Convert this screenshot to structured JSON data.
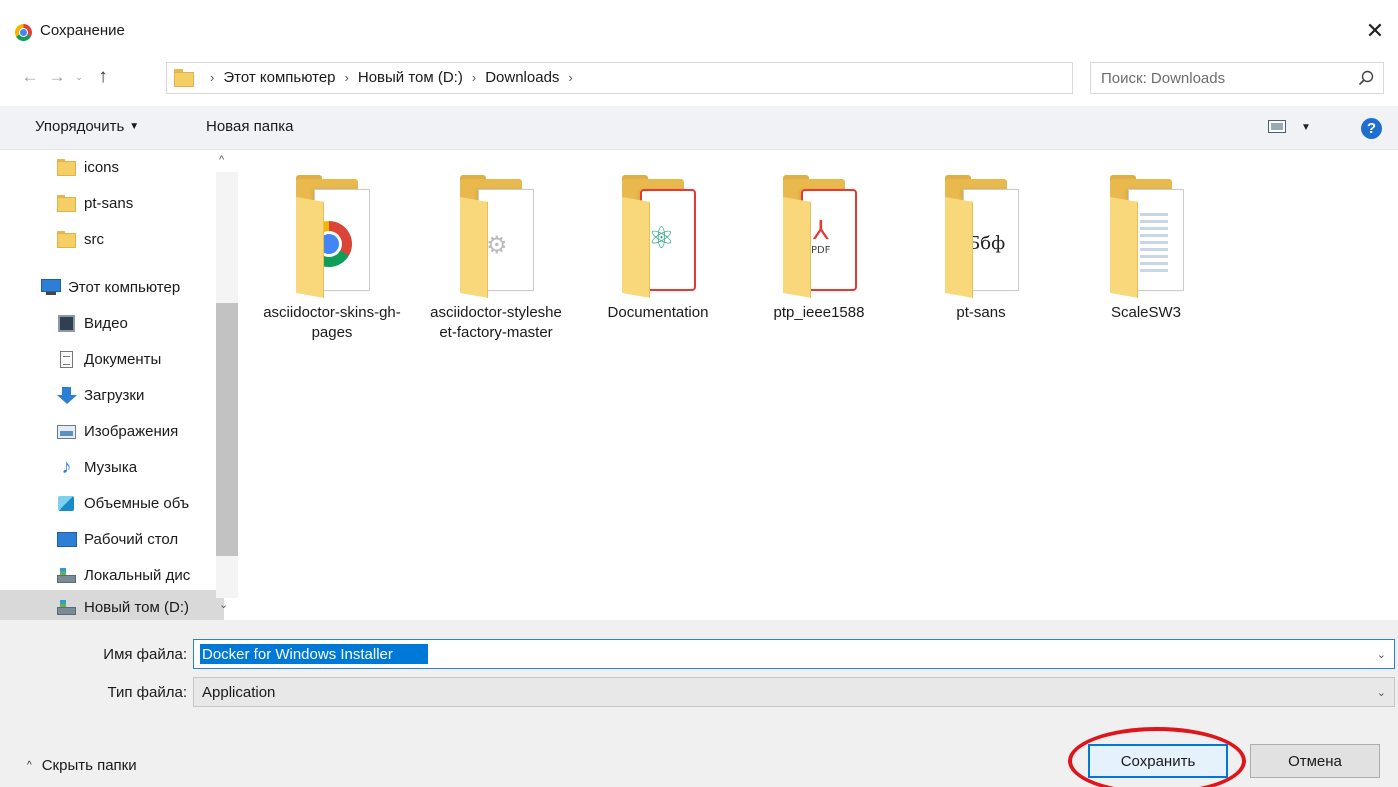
{
  "window": {
    "title": "Сохранение",
    "close_glyph": "✕"
  },
  "nav": {
    "back": "←",
    "forward": "→",
    "recent": "⌄",
    "up": "↑"
  },
  "address": {
    "crumbs": [
      "Этот компьютер",
      "Новый том (D:)",
      "Downloads"
    ],
    "separator": "›",
    "dropdown_glyph": "⌄",
    "refresh_glyph": "↻"
  },
  "search": {
    "placeholder": "Поиск: Downloads"
  },
  "toolbar": {
    "organize": "Упорядочить",
    "organize_arrow": "▼",
    "new_folder": "Новая папка",
    "view_arrow": "▼",
    "help": "?"
  },
  "sidebar": {
    "items": [
      {
        "label": "icons",
        "icon": "folder-icon"
      },
      {
        "label": "pt-sans",
        "icon": "folder-icon"
      },
      {
        "label": "src",
        "icon": "folder-icon"
      },
      {
        "label": "Этот компьютер",
        "icon": "computer-icon"
      },
      {
        "label": "Видео",
        "icon": "video-icon"
      },
      {
        "label": "Документы",
        "icon": "documents-icon"
      },
      {
        "label": "Загрузки",
        "icon": "downloads-icon"
      },
      {
        "label": "Изображения",
        "icon": "pictures-icon"
      },
      {
        "label": "Музыка",
        "icon": "music-icon"
      },
      {
        "label": "Объемные объ",
        "icon": "3d-objects-icon"
      },
      {
        "label": "Рабочий стол",
        "icon": "desktop-icon"
      },
      {
        "label": "Локальный дис",
        "icon": "drive-icon"
      },
      {
        "label": "Новый том (D:)",
        "icon": "drive-icon",
        "selected": true
      }
    ],
    "scroll_up": "^",
    "scroll_down": "⌄"
  },
  "files": [
    {
      "name": "asciidoctor-skins-gh-pages",
      "icon": "chrome-folder-icon"
    },
    {
      "name": "asciidoctor-stylesheet-factory-master",
      "icon": "gear-folder-icon"
    },
    {
      "name": "Documentation",
      "icon": "atom-folder-icon"
    },
    {
      "name": "ptp_ieee1588",
      "icon": "pdf-folder-icon"
    },
    {
      "name": "pt-sans",
      "icon": "font-folder-icon"
    },
    {
      "name": "ScaleSW3",
      "icon": "doc-folder-icon"
    }
  ],
  "file_icon_glyphs": {
    "atom": "⚛",
    "pdf_text": "PDF",
    "pdf_swirl": "⅄",
    "font_text": "Ббф",
    "gear": "⚙"
  },
  "form": {
    "filename_label": "Имя файла:",
    "filename_value": "Docker for Windows Installer",
    "filetype_label": "Тип файла:",
    "filetype_value": "Application",
    "chevron": "⌄"
  },
  "footer": {
    "hide_folders": "Скрыть папки",
    "hide_chevron": "^",
    "save": "Сохранить",
    "cancel": "Отмена"
  },
  "colors": {
    "accent": "#0078d7",
    "annotation": "#e0151b",
    "folder": "#f5cf66"
  }
}
